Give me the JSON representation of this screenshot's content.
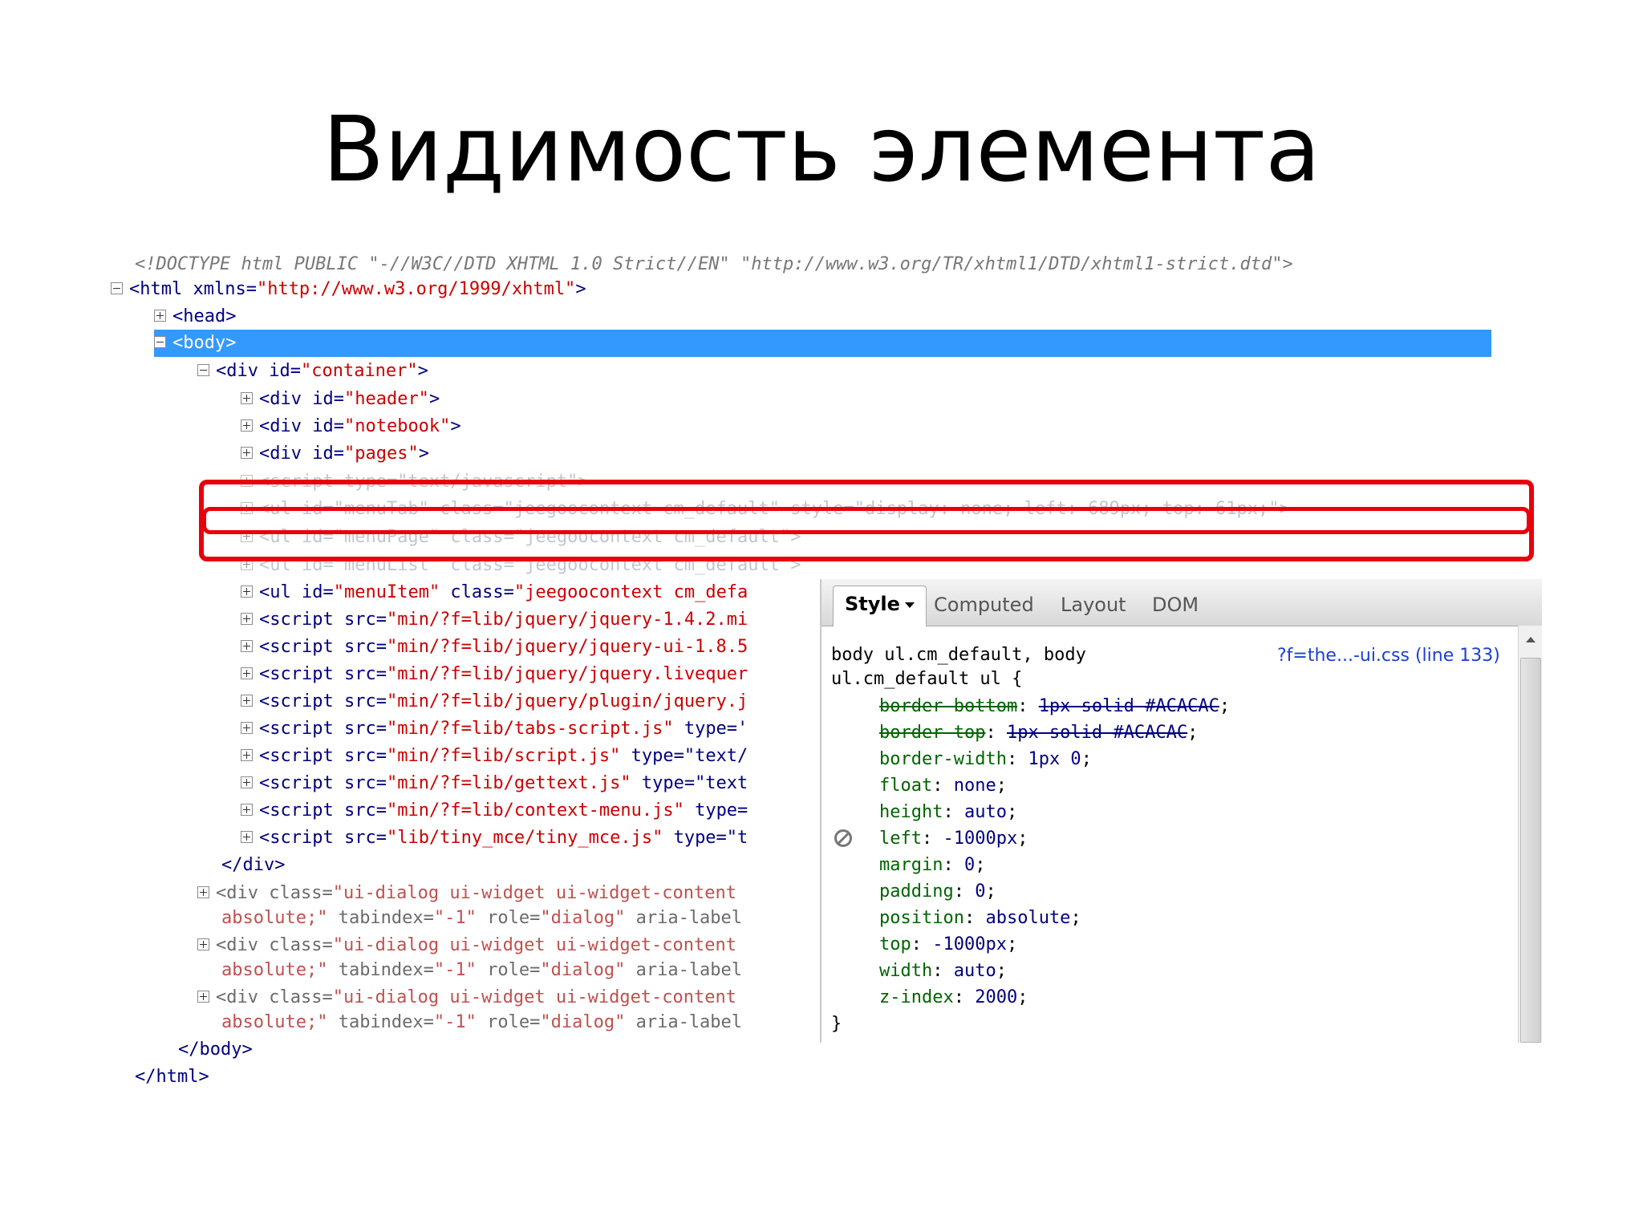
{
  "slide": {
    "title": "Видимость элемента"
  },
  "tree": {
    "doctype": "<!DOCTYPE html PUBLIC \"-//W3C//DTD XHTML 1.0 Strict//EN\" \"http://www.w3.org/TR/xhtml1/DTD/xhtml1-strict.dtd\">",
    "html_tag": "<html",
    "html_attr": " xmlns=",
    "html_val": "\"http://www.w3.org/1999/xhtml\"",
    "html_end": ">",
    "head": "<head>",
    "body": "<body>",
    "container_tag": "<div",
    "container_attr": " id=",
    "container_val": "\"container\"",
    "close_gt": ">",
    "header_val": "\"header\"",
    "notebook_val": "\"notebook\"",
    "pages_val": "\"pages\"",
    "hidden_script": "<script type=\"text/javascript\">",
    "hidden_menutab": "<ul id=\"menuTab\" class=\"jeegoocontext cm_default\" style=\"display: none; left: 689px; top: 61px;\">",
    "hidden_menupage": "<ul id=\"menuPage\" class=\"jeegoocontext cm_default\">",
    "hidden_menulist": "<ul id=\"menuList\" class=\"jeegoocontext cm_default\">",
    "menuitem_tag": "<ul",
    "menuitem_attr1": " id=",
    "menuitem_val1": "\"menuItem\"",
    "menuitem_attr2": " class=",
    "menuitem_val2": "\"jeegoocontext cm_defa",
    "script_tag": "<script",
    "script_attr": " src=",
    "scripts": [
      {
        "src": "\"min/?f=lib/jquery/jquery-1.4.2.mi",
        "rest": ""
      },
      {
        "src": "\"min/?f=lib/jquery/jquery-ui-1.8.5",
        "rest": ""
      },
      {
        "src": "\"min/?f=lib/jquery/jquery.livequer",
        "rest": ""
      },
      {
        "src": "\"min/?f=lib/jquery/plugin/jquery.j",
        "rest": ""
      },
      {
        "src": "\"min/?f=lib/tabs-script.js\"",
        "rest": " type='"
      },
      {
        "src": "\"min/?f=lib/script.js\"",
        "rest": " type=\"text/"
      },
      {
        "src": "\"min/?f=lib/gettext.js\"",
        "rest": " type=\"text"
      },
      {
        "src": "\"min/?f=lib/context-menu.js\"",
        "rest": " type="
      },
      {
        "src": "\"lib/tiny_mce/tiny_mce.js\"",
        "rest": " type=\"t"
      }
    ],
    "close_div": "</div>",
    "dialog_tag": "<div",
    "dialog_attr": " class=",
    "dialog_val": "\"ui-dialog ui-widget ui-widget-content",
    "dialog_line2_val": "absolute;\"",
    "dialog_line2_a1": " tabindex=",
    "dialog_line2_v1": "\"-1\"",
    "dialog_line2_a2": " role=",
    "dialog_line2_v2": "\"dialog\"",
    "dialog_line2_a3": " aria-label",
    "close_body": "</body>",
    "close_html": "</html>"
  },
  "style_panel": {
    "tabs": {
      "style": "Style",
      "computed": "Computed",
      "layout": "Layout",
      "dom": "DOM"
    },
    "selector_line1": "body ul.cm_default, body",
    "selector_line2": "ul.cm_default ul {",
    "source_link": "?f=the...-ui.css (line 133)",
    "rules": [
      {
        "prop": "border-bottom",
        "val": "1px solid #ACACAC",
        "overridden": true
      },
      {
        "prop": "border-top",
        "val": "1px solid #ACACAC",
        "overridden": true
      },
      {
        "prop": "border-width",
        "val": "1px 0",
        "overridden": false
      },
      {
        "prop": "float",
        "val": "none",
        "overridden": false
      },
      {
        "prop": "height",
        "val": "auto",
        "overridden": false
      },
      {
        "prop": "left",
        "val": "-1000px",
        "overridden": false
      },
      {
        "prop": "margin",
        "val": "0",
        "overridden": false
      },
      {
        "prop": "padding",
        "val": "0",
        "overridden": false
      },
      {
        "prop": "position",
        "val": "absolute",
        "overridden": false
      },
      {
        "prop": "top",
        "val": "-1000px",
        "overridden": false
      },
      {
        "prop": "width",
        "val": "auto",
        "overridden": false
      },
      {
        "prop": "z-index",
        "val": "2000",
        "overridden": false
      }
    ],
    "punct": {
      "colon": ": ",
      "semi": ";"
    },
    "closing_brace": "}"
  },
  "colors": {
    "selection": "#3399ff",
    "highlight_box": "#e8000a",
    "tag": "#000080",
    "value": "#cc0000",
    "property": "#006400",
    "link": "#1c3fd6"
  }
}
